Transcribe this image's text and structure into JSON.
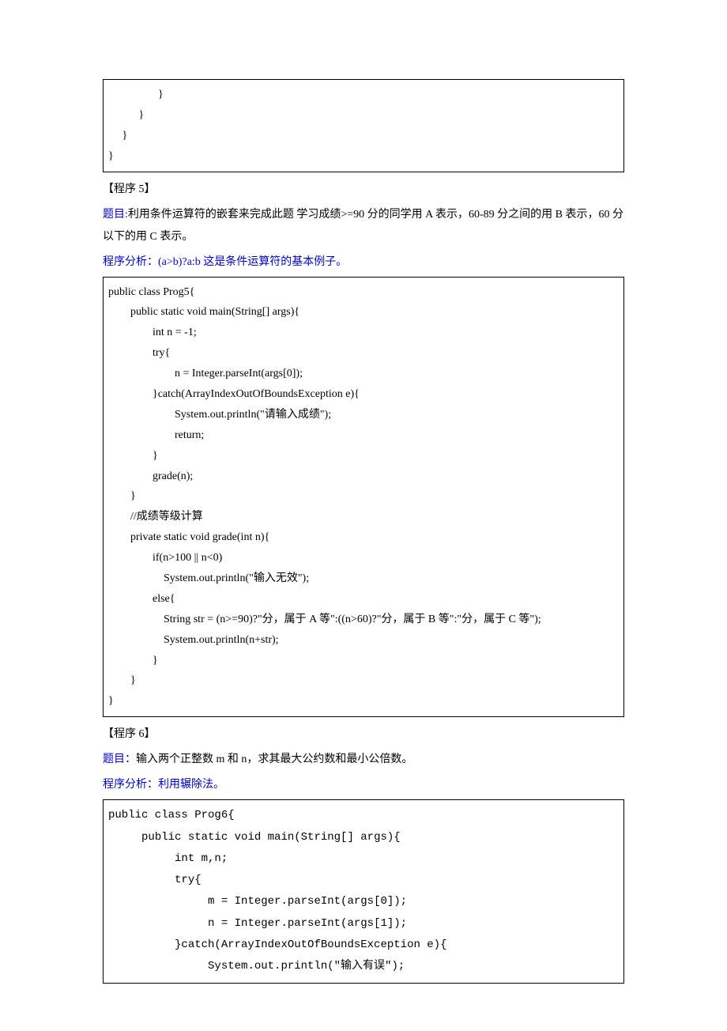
{
  "block1": {
    "code": "                  }\n           }\n     }\n}"
  },
  "prog5": {
    "title": "【程序 5】",
    "question_prefix": "题目:",
    "question_body": "利用条件运算符的嵌套来完成此题 学习成绩>=90 分的同学用 A 表示，60-89 分之间的用 B 表示，60 分以下的用 C 表示。",
    "analysis_label": "程序分析：",
    "analysis_body": "(a>b)?a:b 这是条件运算符的基本例子。",
    "code": "public class Prog5{\n        public static void main(String[] args){\n                int n = -1;\n                try{\n                        n = Integer.parseInt(args[0]);\n                }catch(ArrayIndexOutOfBoundsException e){\n                        System.out.println(\"请输入成绩\");\n                        return;\n                }\n                grade(n);\n        }\n        //成绩等级计算\n        private static void grade(int n){\n                if(n>100 || n<0)\n                    System.out.println(\"输入无效\");\n                else{\n                    String str = (n>=90)?\"分，属于 A 等\":((n>60)?\"分，属于 B 等\":\"分，属于 C 等\");\n                    System.out.println(n+str);\n                }\n        }\n}"
  },
  "prog6": {
    "title": "【程序 6】",
    "question_prefix": "题目：",
    "question_body": "输入两个正整数 m 和 n，求其最大公约数和最小公倍数。",
    "analysis_label": "程序分析：",
    "analysis_body": "利用辗除法。",
    "code": "public class Prog6{\n     public static void main(String[] args){\n          int m,n;\n          try{\n               m = Integer.parseInt(args[0]);\n               n = Integer.parseInt(args[1]);\n          }catch(ArrayIndexOutOfBoundsException e){\n               System.out.println(\"输入有误\");"
  }
}
